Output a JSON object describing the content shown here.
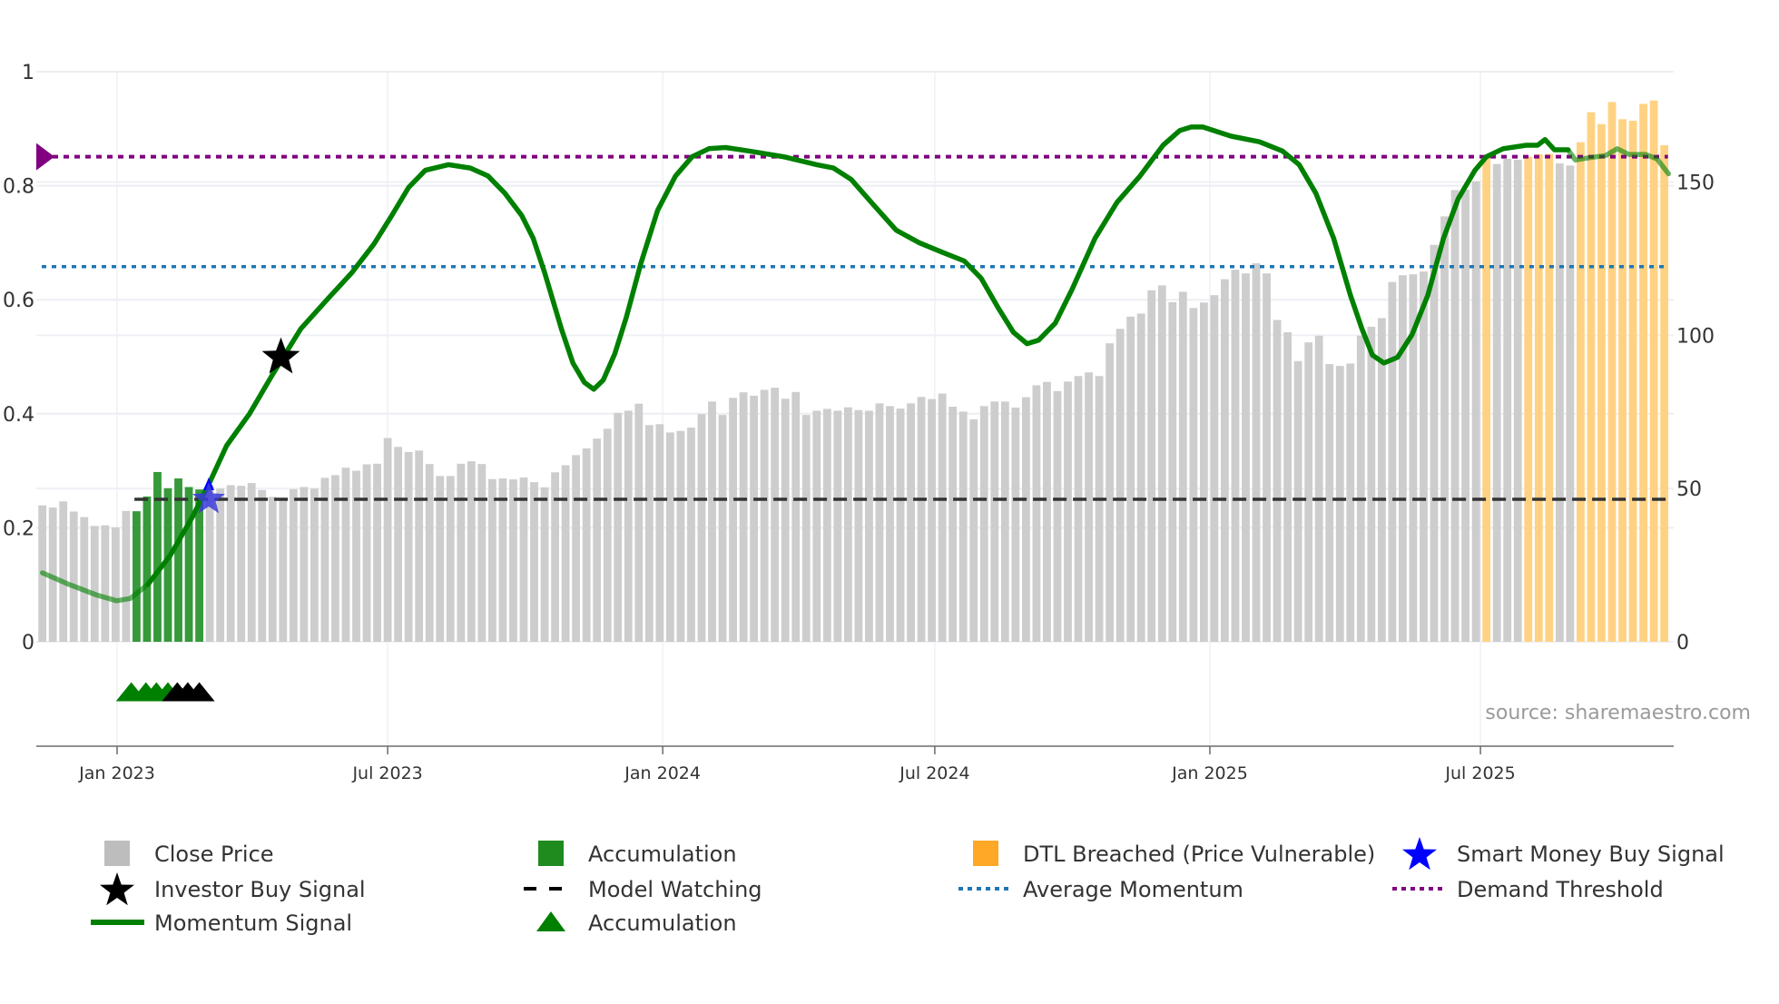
{
  "chart_data": {
    "type": "bar",
    "title": "",
    "source": "source: sharemaestro.com",
    "start_date": "2022-11-12",
    "frequency": "weekly",
    "left_axis": {
      "ticks": [
        "0",
        "0.2",
        "0.4",
        "0.6",
        "0.8",
        "1"
      ],
      "tick_values": [
        0,
        0.2,
        0.4,
        0.6,
        0.8,
        1
      ],
      "range": [
        -0.183,
        1
      ]
    },
    "right_axis": {
      "ticks": [
        "0",
        "50",
        "100",
        "150"
      ],
      "tick_values": [
        0,
        50,
        100,
        150
      ],
      "range": [
        0,
        186
      ]
    },
    "x_ticks": [
      {
        "label": "Jan 2023",
        "date": "2023-01-01"
      },
      {
        "label": "Jul 2023",
        "date": "2023-07-01"
      },
      {
        "label": "Jan 2024",
        "date": "2024-01-01"
      },
      {
        "label": "Jul 2024",
        "date": "2024-07-01"
      },
      {
        "label": "Jan 2025",
        "date": "2025-01-01"
      },
      {
        "label": "Jul 2025",
        "date": "2025-07-01"
      }
    ],
    "close_price": [
      44.5,
      43.8,
      45.8,
      42.5,
      40.7,
      37.8,
      38.0,
      37.3,
      42.7,
      42.6,
      47.4,
      55.4,
      50.1,
      53.3,
      50.5,
      49.7,
      51.2,
      50.0,
      51.1,
      50.9,
      51.8,
      49.5,
      47.3,
      46.2,
      49.8,
      50.5,
      50.0,
      53.5,
      54.4,
      56.8,
      55.8,
      57.9,
      58.1,
      66.5,
      63.6,
      61.9,
      62.4,
      58.0,
      54.1,
      54.1,
      58.1,
      58.9,
      58.0,
      53.1,
      53.3,
      53.0,
      53.6,
      52.1,
      50.4,
      55.3,
      57.6,
      60.9,
      63.1,
      66.3,
      69.5,
      74.7,
      75.4,
      77.7,
      70.7,
      71.0,
      68.3,
      68.8,
      69.9,
      74.3,
      78.4,
      74.0,
      79.6,
      81.4,
      80.3,
      82.2,
      82.9,
      79.3,
      81.5,
      74.0,
      75.4,
      76.0,
      75.4,
      76.5,
      75.6,
      75.4,
      77.8,
      76.9,
      76.1,
      77.8,
      79.9,
      79.2,
      81.0,
      76.7,
      75.1,
      72.6,
      76.9,
      78.4,
      78.4,
      76.4,
      79.8,
      83.7,
      84.8,
      81.8,
      84.9,
      86.7,
      87.9,
      86.7,
      97.4,
      102.1,
      106.1,
      107.1,
      114.7,
      116.3,
      110.8,
      114.2,
      108.9,
      110.7,
      113.1,
      118.3,
      121.4,
      120.2,
      123.5,
      120.2,
      105.0,
      101.0,
      91.6,
      97.7,
      99.9,
      90.6,
      90.0,
      90.8,
      99.9,
      102.8,
      105.6,
      117.4,
      119.6,
      119.9,
      120.8,
      129.5,
      138.8,
      147.4,
      147.5,
      150.3,
      158.3,
      155.9,
      157.6,
      157.3,
      158.3,
      159.1,
      159.2,
      156.1,
      155.4,
      163.0,
      172.8,
      168.9,
      176.1,
      170.5,
      170.0,
      175.5,
      176.6,
      162.0
    ],
    "accumulation_bars": [
      9,
      10,
      11,
      12,
      13,
      14,
      15
    ],
    "dtl_breached_bars": [
      138,
      142,
      143,
      144,
      147,
      148,
      149,
      150,
      151,
      152,
      153,
      154,
      155
    ],
    "momentum": {
      "week": [
        0,
        2.5,
        5.2,
        7.1,
        8.4,
        10.1,
        12.2,
        14.4,
        16,
        17.6,
        19.8,
        22,
        24.7,
        27.4,
        29.6,
        31.7,
        33.4,
        35,
        36.6,
        38.8,
        40.9,
        42.6,
        44.2,
        45.8,
        46.9,
        48,
        49.6,
        50.7,
        51.8,
        52.7,
        53.6,
        54.7,
        55.8,
        57.2,
        58.8,
        60.5,
        62.1,
        63.7,
        65.3,
        67.5,
        70.8,
        74,
        75.6,
        77.3,
        79.4,
        81.6,
        83.8,
        85.9,
        88.1,
        89.7,
        91.4,
        92.8,
        94.1,
        95.2,
        96.8,
        98.4,
        100.6,
        102.7,
        104.9,
        107.1,
        108.7,
        109.8,
        110.9,
        113.6,
        116.3,
        118.5,
        120.1,
        121.7,
        123.4,
        125,
        126.1,
        127.1,
        128.2,
        129.5,
        130.9,
        132.4,
        133.9,
        135.3,
        136.9,
        138,
        139.6,
        141.8,
        142.9,
        143.6,
        144.5,
        145.8,
        146.5,
        147.8,
        149.4,
        150.5,
        151.6,
        153.2,
        154.3,
        155.4
      ],
      "value": [
        0.121,
        0.101,
        0.082,
        0.072,
        0.076,
        0.101,
        0.151,
        0.221,
        0.28,
        0.344,
        0.4,
        0.469,
        0.549,
        0.604,
        0.648,
        0.698,
        0.748,
        0.797,
        0.827,
        0.837,
        0.831,
        0.817,
        0.787,
        0.748,
        0.708,
        0.648,
        0.549,
        0.489,
        0.455,
        0.443,
        0.459,
        0.505,
        0.569,
        0.664,
        0.757,
        0.817,
        0.851,
        0.865,
        0.867,
        0.861,
        0.851,
        0.837,
        0.831,
        0.811,
        0.767,
        0.722,
        0.7,
        0.684,
        0.668,
        0.638,
        0.584,
        0.543,
        0.523,
        0.529,
        0.559,
        0.618,
        0.708,
        0.771,
        0.817,
        0.871,
        0.897,
        0.903,
        0.903,
        0.887,
        0.877,
        0.861,
        0.837,
        0.787,
        0.708,
        0.608,
        0.549,
        0.503,
        0.489,
        0.499,
        0.539,
        0.608,
        0.708,
        0.777,
        0.827,
        0.851,
        0.865,
        0.871,
        0.871,
        0.881,
        0.863,
        0.863,
        0.845,
        0.849,
        0.853,
        0.865,
        0.855,
        0.855,
        0.847,
        0.821
      ]
    },
    "model_watching": {
      "value": 0.25,
      "from_week": 8.8
    },
    "average_momentum": 0.658,
    "demand_threshold": 0.851,
    "smart_money_buy_signal": {
      "week": 15.9,
      "value": 0.25
    },
    "investor_buy_signal": {
      "week": 22.8,
      "value": 0.499
    },
    "accumulation_triangles": {
      "green_weeks": [
        8.5,
        9.9,
        10.9,
        12
      ],
      "black_weeks": [
        12.9,
        13.9,
        15
      ],
      "value": -0.09
    },
    "legend": [
      {
        "label": "Close Price",
        "symbol": "square",
        "color": "#bdbdbd"
      },
      {
        "label": "Accumulation",
        "symbol": "square",
        "color": "#1f8b1f"
      },
      {
        "label": "DTL Breached (Price Vulnerable)",
        "symbol": "square",
        "color": "#ffa726"
      },
      {
        "label": "Smart Money Buy Signal",
        "symbol": "star",
        "color": "#0000ff"
      },
      {
        "label": "Investor Buy Signal",
        "symbol": "star",
        "color": "#000000"
      },
      {
        "label": "Model Watching",
        "symbol": "dash",
        "color": "#000000"
      },
      {
        "label": "Average Momentum",
        "symbol": "dot",
        "color": "#1f77b4"
      },
      {
        "label": "Demand Threshold",
        "symbol": "dot",
        "color": "#800080"
      },
      {
        "label": "Momentum Signal",
        "symbol": "line",
        "color": "#008000"
      },
      {
        "label": "Accumulation",
        "symbol": "triangle",
        "color": "#008000"
      }
    ],
    "legend_position": "bottom",
    "colors": {
      "price": "#cdcdcd",
      "accumulation": "#36993a",
      "dtl": "#ffd283",
      "momentum": "#008000",
      "avg": "#1f77b4",
      "threshold": "#800080",
      "watch": "#333333"
    }
  }
}
